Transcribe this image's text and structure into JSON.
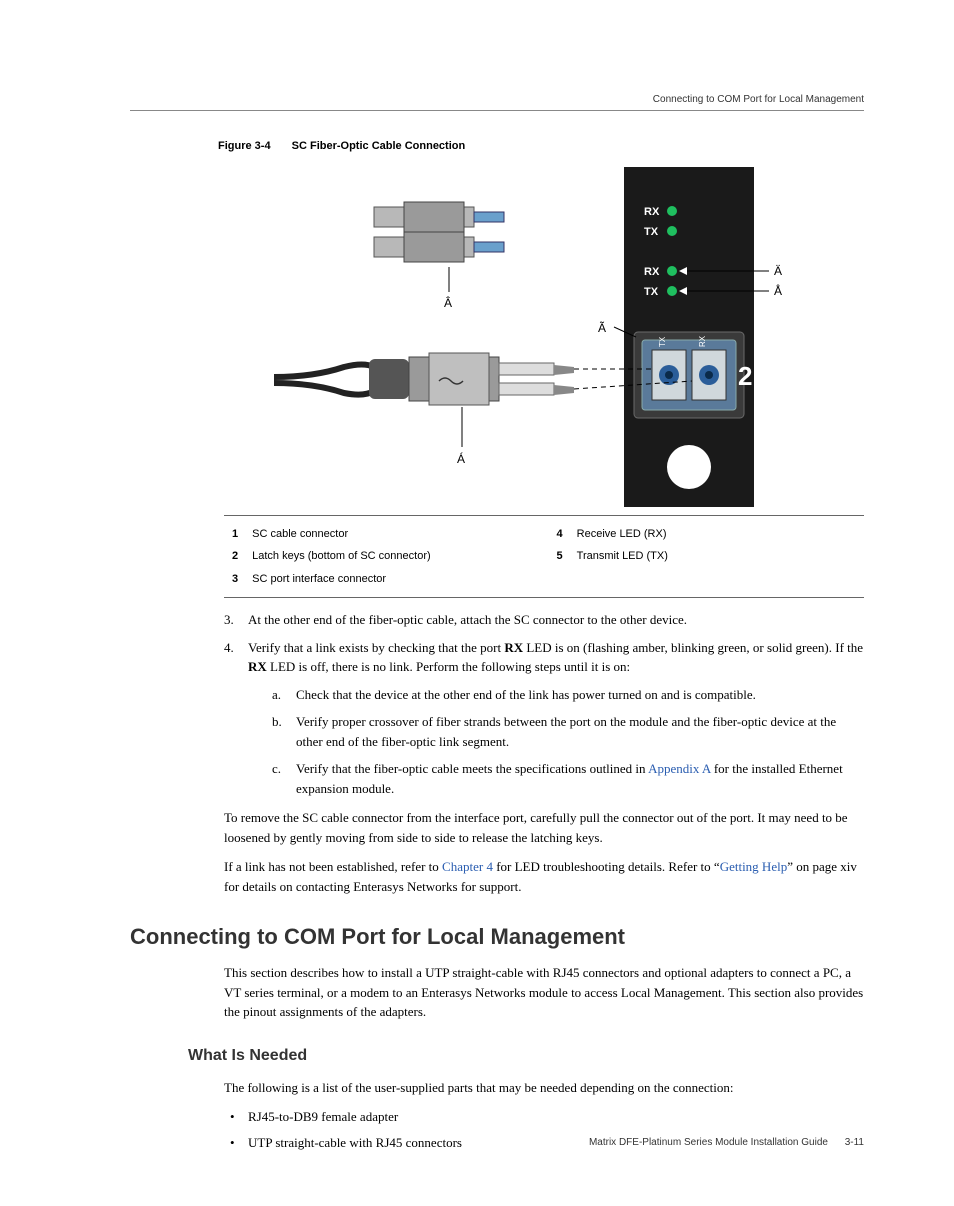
{
  "header": {
    "running_head": "Connecting to COM Port for Local Management"
  },
  "figure": {
    "label": "Figure 3-4",
    "title": "SC Fiber-Optic Cable Connection",
    "callouts": {
      "c1": "Á",
      "c2": "Â",
      "c3": "Ã",
      "c4": "Ä",
      "c5": "Å"
    },
    "labels": {
      "rx1": "RX",
      "tx1": "TX",
      "rx2": "RX",
      "tx2": "TX",
      "port_num": "2",
      "conn_tx": "TX",
      "conn_rx": "RX"
    }
  },
  "legend": [
    {
      "n": "1",
      "text": "SC cable connector"
    },
    {
      "n": "2",
      "text": "Latch keys (bottom of SC connector)"
    },
    {
      "n": "3",
      "text": "SC port interface connector"
    },
    {
      "n": "4",
      "text": "Receive LED (RX)"
    },
    {
      "n": "5",
      "text": "Transmit LED (TX)"
    }
  ],
  "steps": {
    "s3": {
      "marker": "3.",
      "text": "At the other end of the fiber-optic cable, attach the SC connector to the other device."
    },
    "s4": {
      "marker": "4.",
      "pre": "Verify that a link exists by checking that the port ",
      "rx": "RX",
      "mid": " LED is on (flashing amber, blinking green, or solid green). If the ",
      "rx2": "RX",
      "post": " LED is off, there is no link. Perform the following steps until it is on:",
      "a": {
        "marker": "a.",
        "text": "Check that the device at the other end of the link has power turned on and is compatible."
      },
      "b": {
        "marker": "b.",
        "text": "Verify proper crossover of fiber strands between the port on the module and the fiber-optic device at the other end of the fiber-optic link segment."
      },
      "c": {
        "marker": "c.",
        "pre": "Verify that the fiber-optic cable meets the specifications outlined in ",
        "link": "Appendix A",
        "post": " for the installed Ethernet expansion module."
      }
    }
  },
  "paras": {
    "p1": "To remove the SC cable connector from the interface port, carefully pull the connector out of the port. It may need to be loosened by gently moving from side to side to release the latching keys.",
    "p2_pre": "If a link has not been established, refer to ",
    "p2_link1": "Chapter 4",
    "p2_mid": " for LED troubleshooting details. Refer to “",
    "p2_link2": "Getting Help",
    "p2_post": "” on page xiv for details on contacting Enterasys Networks for support."
  },
  "h1": "Connecting to COM Port for Local Management",
  "h1_para": "This section describes how to install a UTP straight-cable with RJ45 connectors and optional adapters to connect a PC, a VT series terminal, or a modem to an Enterasys Networks module to access Local Management. This section also provides the pinout assignments of the adapters.",
  "h2": "What Is Needed",
  "h2_para": "The following is a list of the user-supplied parts that may be needed depending on the connection:",
  "bullets": [
    "RJ45-to-DB9 female adapter",
    "UTP straight-cable with RJ45 connectors"
  ],
  "footer": {
    "title": "Matrix DFE-Platinum Series Module Installation Guide",
    "page": "3-11"
  }
}
